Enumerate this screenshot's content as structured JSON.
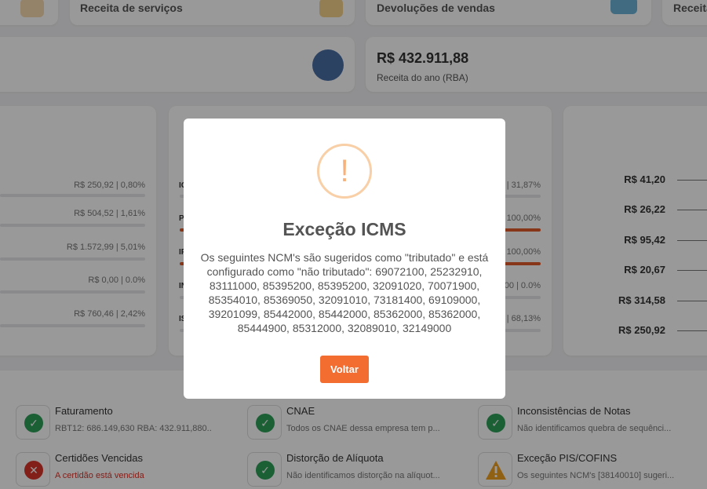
{
  "top_cards": [
    {
      "label": "Receita de serviços"
    },
    {
      "label": "Devoluções de vendas"
    },
    {
      "label": "Receita"
    }
  ],
  "rba_card": {
    "value": "R$ 432.911,88",
    "label": "Receita do ano (RBA)"
  },
  "left_rows": [
    {
      "value": "R$ 250,92 | 0,80%"
    },
    {
      "value": "R$ 504,52 | 1,61%"
    },
    {
      "value": "R$ 1.572,99 | 5,01%"
    },
    {
      "value": "R$ 0,00 | 0.0%"
    },
    {
      "value": "R$ 760,46 | 2,42%"
    }
  ],
  "middle_rows": [
    {
      "code": "IC",
      "value": "| 31,87%",
      "fill": 0.0
    },
    {
      "code": "P",
      "value": "100,00%",
      "fill": 1.0
    },
    {
      "code": "IF",
      "value": "100,00%",
      "fill": 1.0
    },
    {
      "code": "IN",
      "value": "00 | 0.0%",
      "fill": 0.0
    },
    {
      "code": "IS",
      "value": "| 68,13%",
      "fill": 0.0
    }
  ],
  "right_amounts": [
    "R$ 41,20",
    "R$ 26,22",
    "R$ 95,42",
    "R$ 20,67",
    "R$ 314,58",
    "R$ 250,92"
  ],
  "status_items": [
    {
      "title": "Faturamento",
      "desc": "RBT12: 686.149,630 RBA: 432.911,880...",
      "status": "ok"
    },
    {
      "title": "CNAE",
      "desc": "Todos os CNAE dessa empresa tem p...",
      "status": "ok"
    },
    {
      "title": "Inconsistências de Notas",
      "desc": "Não identificamos quebra de sequênci...",
      "status": "ok"
    },
    {
      "title": "Certidões Vencidas",
      "desc": "A certidão está vencida",
      "status": "error"
    },
    {
      "title": "Distorção de Alíquota",
      "desc": "Não identificamos distorção na alíquot...",
      "status": "ok"
    },
    {
      "title": "Exceção PIS/COFINS",
      "desc": "Os seguintes NCM's [38140010] sugeri...",
      "status": "warning"
    }
  ],
  "modal": {
    "icon_char": "!",
    "title": "Exceção ICMS",
    "text": "Os seguintes NCM's são sugeridos como \"tributado\" e está configurado como \"não tributado\": 69072100, 25232910, 83111000, 85395200, 85395200, 32091020, 70071900, 85354010, 85369050, 32091010, 73181400, 69109000, 39201099, 85442000, 85442000, 85362000, 85362000, 85444900, 85312000, 32089010, 32149000",
    "button_label": "Voltar"
  },
  "icons": {
    "ok": "check-icon",
    "error": "x-icon",
    "warning": "warning-icon"
  },
  "colors": {
    "ok": "#2e9e59",
    "error": "#d9342b",
    "warning": "#f0a020",
    "accent": "#f36d31",
    "progress": "#e25a2c",
    "error_text": "#d9342b"
  }
}
